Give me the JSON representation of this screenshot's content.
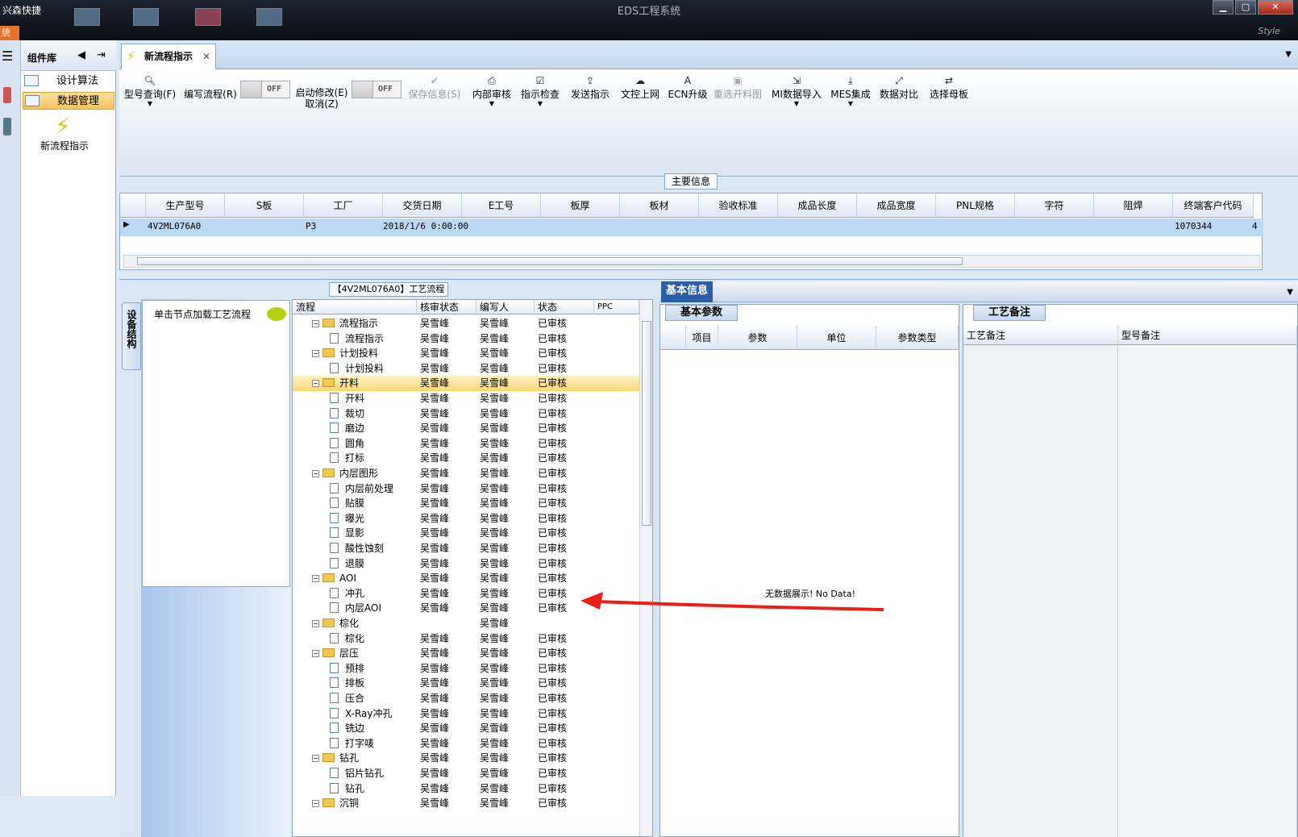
{
  "window": {
    "title": "EDS工程系统",
    "shortcut": "兴森快捷",
    "style_label": "Style",
    "orange_tab": "统"
  },
  "nav": {
    "header": "组件库",
    "items": [
      {
        "label": "设计算法"
      },
      {
        "label": "数据管理"
      }
    ],
    "new_flow_label": "新流程指示"
  },
  "tab": {
    "label": "新流程指示"
  },
  "toolbar": {
    "items": [
      {
        "label": "型号查询(F)",
        "icon": "search-icon"
      },
      {
        "label": "编写流程(R)"
      },
      {
        "label": "启动修改(E)"
      },
      {
        "label": "取消(Z)"
      },
      {
        "label": "保存信息(S)",
        "icon": "check-icon",
        "disabled": true
      },
      {
        "label": "内部审核",
        "icon": "print-icon"
      },
      {
        "label": "指示检查",
        "icon": "checkbox-icon"
      },
      {
        "label": "发送指示",
        "icon": "upload-icon"
      },
      {
        "label": "文控上网",
        "icon": "cloud-upload-icon"
      },
      {
        "label": "ECN升级",
        "icon": "font-icon"
      },
      {
        "label": "重选开料图",
        "icon": "image-icon",
        "disabled": true
      },
      {
        "label": "MI数据导入",
        "icon": "import-icon"
      },
      {
        "label": "MES集成",
        "icon": "download-icon"
      },
      {
        "label": "数据对比",
        "icon": "compare-icon"
      },
      {
        "label": "选择母板",
        "icon": "shuffle-icon"
      }
    ],
    "toggle_off": "OFF"
  },
  "main_info": {
    "title": "主要信息",
    "columns": [
      "生产型号",
      "S板",
      "工厂",
      "交货日期",
      "E工号",
      "板厚",
      "板材",
      "验收标准",
      "成品长度",
      "成品宽度",
      "PNL规格",
      "字符",
      "阻焊",
      "终端客户代码"
    ],
    "row": {
      "model": "4V2ML076A0",
      "factory": "P3",
      "delivery": "2018/1/6 0:00:00",
      "customer_code": "1070344",
      "extra": "4"
    }
  },
  "flow": {
    "title": "【4V2ML076A0】工艺流程",
    "vtab": "设备结构",
    "load_hint": "单击节点加载工艺流程",
    "columns": [
      "流程",
      "核审状态",
      "编写人",
      "状态",
      "PPC"
    ],
    "rows": [
      {
        "name": "流程指示",
        "type": "folder",
        "check": "吴雪峰",
        "writer": "吴雪峰",
        "status": "已审核"
      },
      {
        "name": "流程指示",
        "type": "doc",
        "check": "吴雪峰",
        "writer": "吴雪峰",
        "status": "已审核"
      },
      {
        "name": "计划投料",
        "type": "folder",
        "check": "吴雪峰",
        "writer": "吴雪峰",
        "status": "已审核"
      },
      {
        "name": "计划投料",
        "type": "doc",
        "check": "吴雪峰",
        "writer": "吴雪峰",
        "status": "已审核"
      },
      {
        "name": "开料",
        "type": "folder",
        "check": "吴雪峰",
        "writer": "吴雪峰",
        "status": "已审核",
        "selected": true
      },
      {
        "name": "开料",
        "type": "doc",
        "check": "吴雪峰",
        "writer": "吴雪峰",
        "status": "已审核"
      },
      {
        "name": "裁切",
        "type": "doc",
        "check": "吴雪峰",
        "writer": "吴雪峰",
        "status": "已审核"
      },
      {
        "name": "磨边",
        "type": "doc",
        "check": "吴雪峰",
        "writer": "吴雪峰",
        "status": "已审核"
      },
      {
        "name": "圆角",
        "type": "doc",
        "check": "吴雪峰",
        "writer": "吴雪峰",
        "status": "已审核"
      },
      {
        "name": "打标",
        "type": "doc",
        "check": "吴雪峰",
        "writer": "吴雪峰",
        "status": "已审核"
      },
      {
        "name": "内层图形",
        "type": "folder",
        "check": "吴雪峰",
        "writer": "吴雪峰",
        "status": "已审核"
      },
      {
        "name": "内层前处理",
        "type": "doc",
        "check": "吴雪峰",
        "writer": "吴雪峰",
        "status": "已审核"
      },
      {
        "name": "贴膜",
        "type": "doc",
        "check": "吴雪峰",
        "writer": "吴雪峰",
        "status": "已审核"
      },
      {
        "name": "曝光",
        "type": "doc",
        "check": "吴雪峰",
        "writer": "吴雪峰",
        "status": "已审核"
      },
      {
        "name": "显影",
        "type": "doc",
        "check": "吴雪峰",
        "writer": "吴雪峰",
        "status": "已审核"
      },
      {
        "name": "酸性蚀刻",
        "type": "doc",
        "check": "吴雪峰",
        "writer": "吴雪峰",
        "status": "已审核"
      },
      {
        "name": "退膜",
        "type": "doc",
        "check": "吴雪峰",
        "writer": "吴雪峰",
        "status": "已审核"
      },
      {
        "name": "AOI",
        "type": "folder",
        "check": "吴雪峰",
        "writer": "吴雪峰",
        "status": "已审核"
      },
      {
        "name": "冲孔",
        "type": "doc",
        "check": "吴雪峰",
        "writer": "吴雪峰",
        "status": "已审核"
      },
      {
        "name": "内层AOI",
        "type": "doc",
        "check": "吴雪峰",
        "writer": "吴雪峰",
        "status": "已审核"
      },
      {
        "name": "棕化",
        "type": "folder",
        "check": "",
        "writer": "吴雪峰",
        "status": ""
      },
      {
        "name": "棕化",
        "type": "doc",
        "check": "吴雪峰",
        "writer": "吴雪峰",
        "status": "已审核"
      },
      {
        "name": "层压",
        "type": "folder",
        "check": "吴雪峰",
        "writer": "吴雪峰",
        "status": "已审核"
      },
      {
        "name": "预排",
        "type": "doc",
        "check": "吴雪峰",
        "writer": "吴雪峰",
        "status": "已审核"
      },
      {
        "name": "排板",
        "type": "doc",
        "check": "吴雪峰",
        "writer": "吴雪峰",
        "status": "已审核"
      },
      {
        "name": "压合",
        "type": "doc",
        "check": "吴雪峰",
        "writer": "吴雪峰",
        "status": "已审核"
      },
      {
        "name": "X-Ray冲孔",
        "type": "doc",
        "check": "吴雪峰",
        "writer": "吴雪峰",
        "status": "已审核"
      },
      {
        "name": "铣边",
        "type": "doc",
        "check": "吴雪峰",
        "writer": "吴雪峰",
        "status": "已审核"
      },
      {
        "name": "打字唛",
        "type": "doc",
        "check": "吴雪峰",
        "writer": "吴雪峰",
        "status": "已审核"
      },
      {
        "name": "钻孔",
        "type": "folder",
        "check": "吴雪峰",
        "writer": "吴雪峰",
        "status": "已审核"
      },
      {
        "name": "铝片钻孔",
        "type": "doc",
        "check": "吴雪峰",
        "writer": "吴雪峰",
        "status": "已审核"
      },
      {
        "name": "钻孔",
        "type": "doc",
        "check": "吴雪峰",
        "writer": "吴雪峰",
        "status": "已审核"
      },
      {
        "name": "沉铜",
        "type": "folder",
        "check": "吴雪峰",
        "writer": "吴雪峰",
        "status": "已审核"
      }
    ]
  },
  "basic": {
    "tab": "基本信息",
    "params_tab": "基本参数",
    "columns": [
      "项目",
      "参数",
      "单位",
      "参数类型"
    ],
    "no_data": "无数据展示! No Data!"
  },
  "notes": {
    "tab": "工艺备注",
    "columns": [
      "工艺备注",
      "型号备注"
    ]
  },
  "colors": {
    "selection": "#bcd8f4",
    "row_highlight": "#fbd873",
    "annotation_arrow": "#e8201a"
  }
}
